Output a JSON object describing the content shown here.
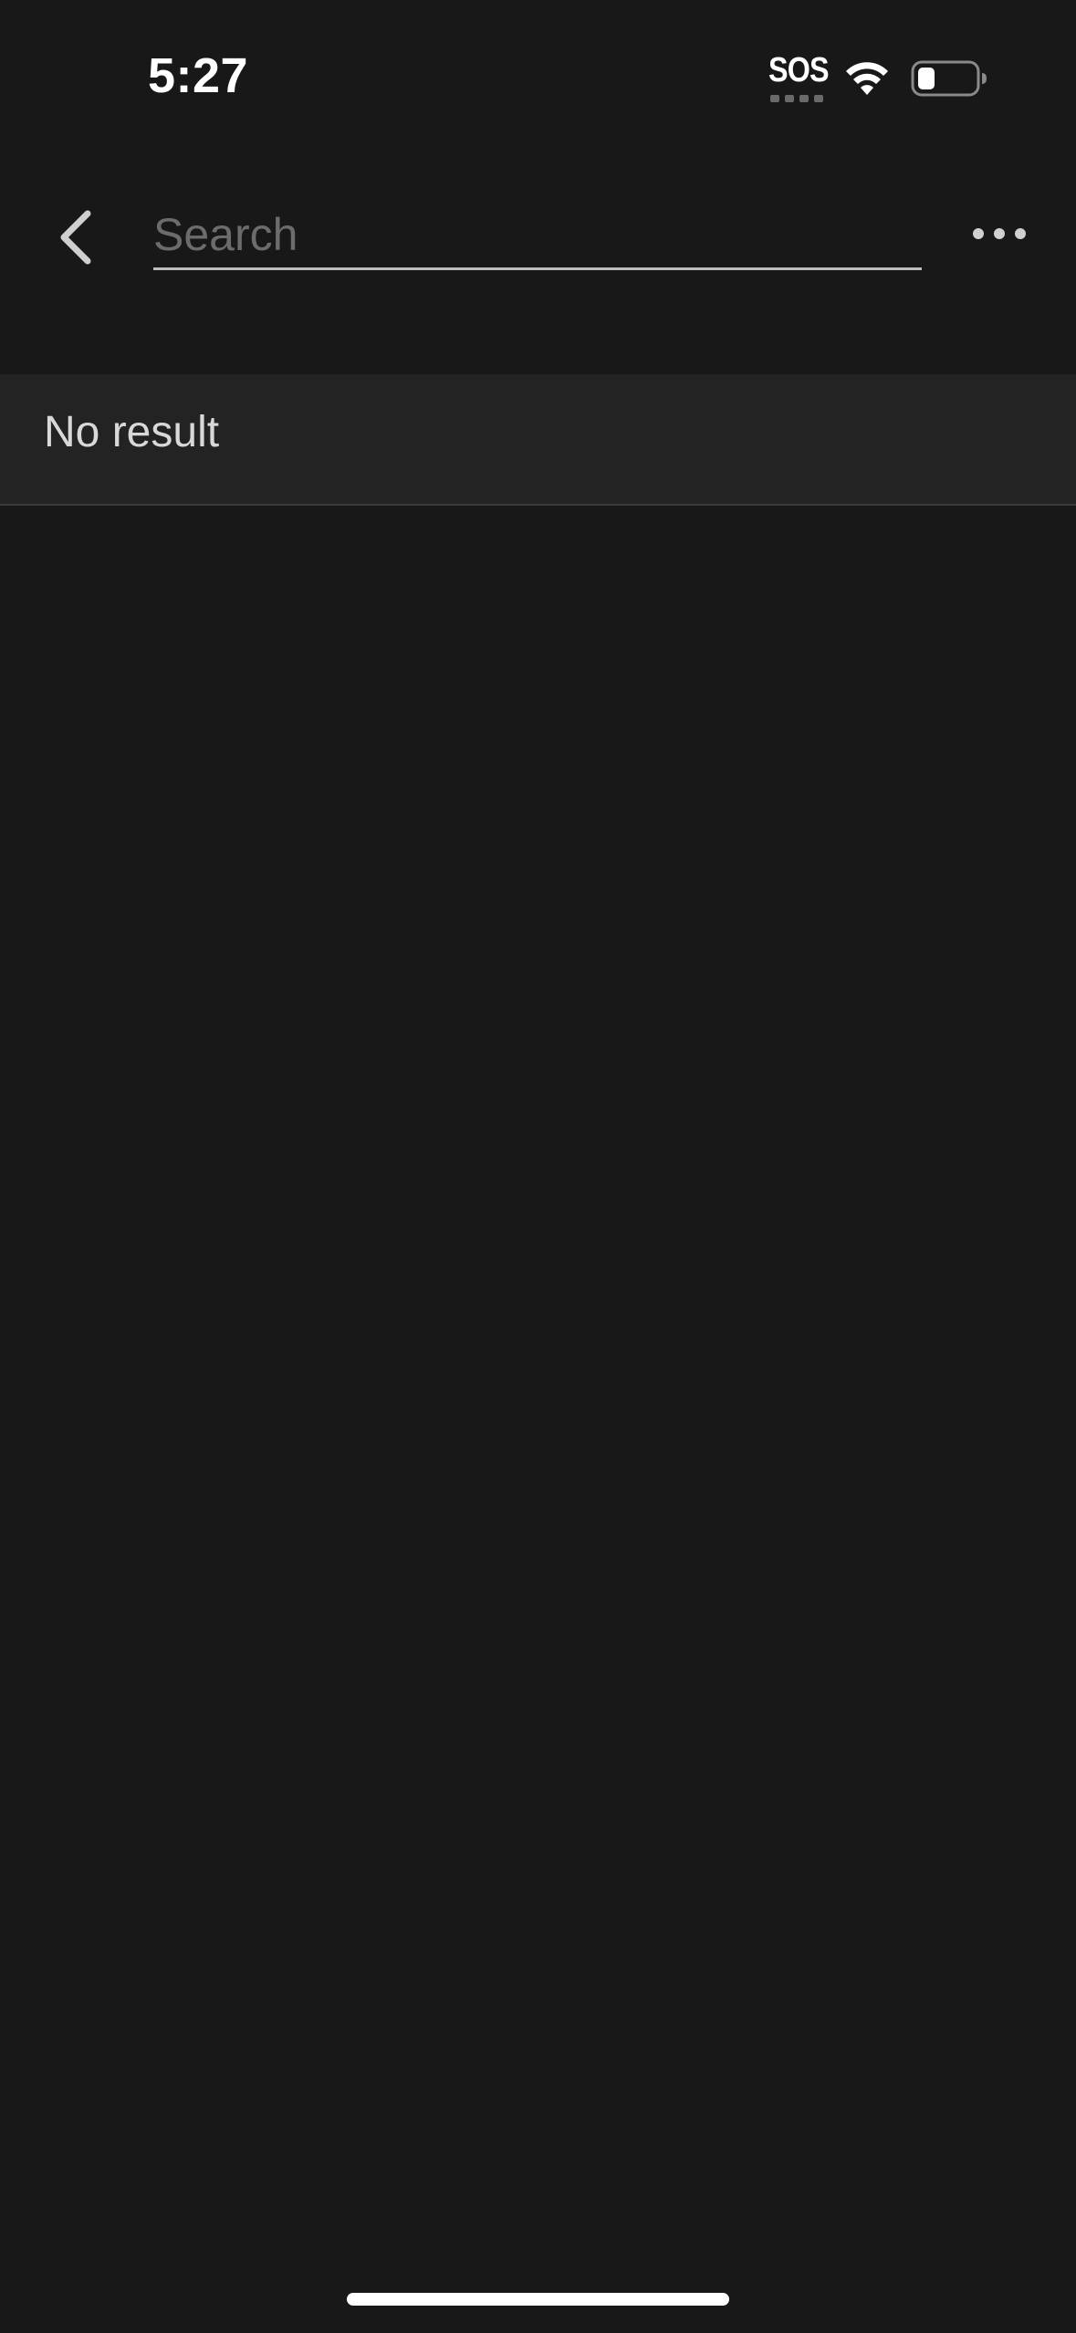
{
  "status_bar": {
    "time": "5:27",
    "carrier": "SOS",
    "icons": [
      "sos-signal-icon",
      "wifi-icon",
      "battery-icon"
    ]
  },
  "header": {
    "back_icon": "chevron-left-icon",
    "search": {
      "value": "",
      "placeholder": "Search"
    },
    "more_icon": "more-horizontal-icon"
  },
  "results": {
    "empty_message": "No result"
  },
  "colors": {
    "background": "#181818",
    "row_background": "#232323",
    "text": "#d8d8d8",
    "placeholder": "#6c6c6c",
    "underline": "#bdbdbd"
  }
}
